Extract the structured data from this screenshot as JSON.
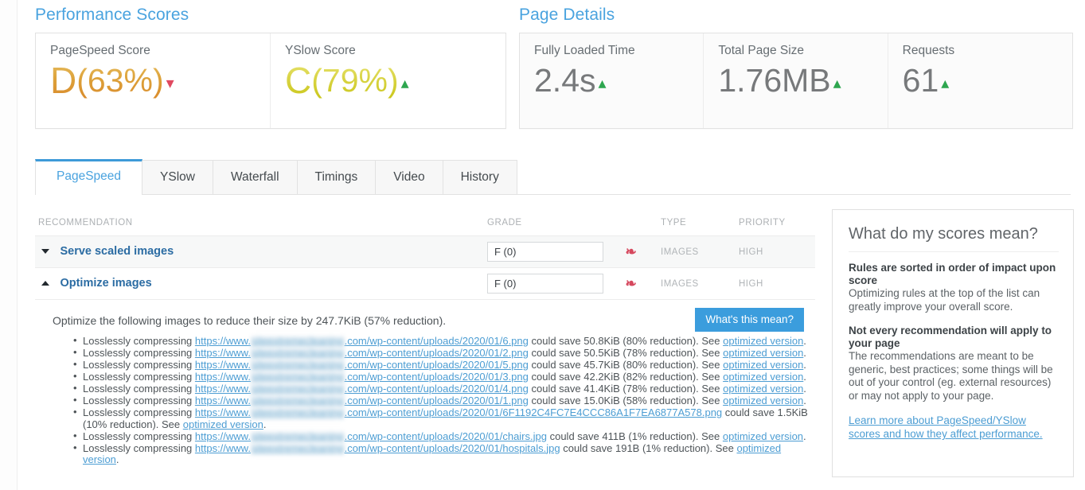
{
  "performance": {
    "heading": "Performance Scores",
    "cards": [
      {
        "label": "PageSpeed Score",
        "grade": "D",
        "percent": "(63%)",
        "trend": "down"
      },
      {
        "label": "YSlow Score",
        "grade": "C",
        "percent": "(79%)",
        "trend": "up"
      }
    ]
  },
  "page_details": {
    "heading": "Page Details",
    "cards": [
      {
        "label": "Fully Loaded Time",
        "value": "2.4s",
        "trend": "up"
      },
      {
        "label": "Total Page Size",
        "value": "1.76MB",
        "trend": "up"
      },
      {
        "label": "Requests",
        "value": "61",
        "trend": "up"
      }
    ]
  },
  "tabs": [
    {
      "label": "PageSpeed",
      "active": true
    },
    {
      "label": "YSlow",
      "active": false
    },
    {
      "label": "Waterfall",
      "active": false
    },
    {
      "label": "Timings",
      "active": false
    },
    {
      "label": "Video",
      "active": false
    },
    {
      "label": "History",
      "active": false
    }
  ],
  "table": {
    "headers": {
      "recommendation": "RECOMMENDATION",
      "grade": "GRADE",
      "type": "TYPE",
      "priority": "PRIORITY"
    },
    "rows": [
      {
        "name": "Serve scaled images",
        "toggle": "down",
        "grade": "F (0)",
        "type": "IMAGES",
        "priority": "HIGH"
      },
      {
        "name": "Optimize images",
        "toggle": "up",
        "grade": "F (0)",
        "type": "IMAGES",
        "priority": "HIGH"
      }
    ]
  },
  "detail": {
    "lead": "Optimize the following images to reduce their size by 247.7KiB (57% reduction).",
    "whats_this_mean": "What's this mean?",
    "prefix": "Losslessly compressing ",
    "url_head": "https://www.",
    "url_domain_blurred": "siteextremecleaning",
    "link_text": "optimized version",
    "items": [
      {
        "path": ".com/wp-content/uploads/2020/01/6.png",
        "save": " could save 50.8KiB (80% reduction). See ",
        "tail": "."
      },
      {
        "path": ".com/wp-content/uploads/2020/01/2.png",
        "save": " could save 50.5KiB (78% reduction). See ",
        "tail": "."
      },
      {
        "path": ".com/wp-content/uploads/2020/01/5.png",
        "save": " could save 45.7KiB (80% reduction). See ",
        "tail": "."
      },
      {
        "path": ".com/wp-content/uploads/2020/01/3.png",
        "save": " could save 42.2KiB (82% reduction). See ",
        "tail": "."
      },
      {
        "path": ".com/wp-content/uploads/2020/01/4.png",
        "save": " could save 41.4KiB (78% reduction). See ",
        "tail": "."
      },
      {
        "path": ".com/wp-content/uploads/2020/01/1.png",
        "save": " could save 15.0KiB (58% reduction). See ",
        "tail": "."
      },
      {
        "path": ".com/wp-content/uploads/2020/01/6F1192C4FC7E4CCC86A1F7EA6877A578.png",
        "save": " could save 1.5KiB (10% reduction). See ",
        "tail": "."
      },
      {
        "path": ".com/wp-content/uploads/2020/01/chairs.jpg",
        "save": " could save 411B (1% reduction). See ",
        "tail": "."
      },
      {
        "path": ".com/wp-content/uploads/2020/01/hospitals.jpg",
        "save": " could save 191B (1% reduction). See ",
        "tail": "."
      }
    ]
  },
  "info_panel": {
    "title": "What do my scores mean?",
    "sections": [
      {
        "heading": "Rules are sorted in order of impact upon score",
        "body": "Optimizing rules at the top of the list can greatly improve your overall score."
      },
      {
        "heading": "Not every recommendation will apply to your page",
        "body": "The recommendations are meant to be generic, best practices; some things will be out of your control (eg. external resources) or may not apply to your page."
      }
    ],
    "link": "Learn more about PageSpeed/YSlow scores and how they affect performance."
  },
  "colors": {
    "accent_blue": "#4aa3df",
    "grade_d": "#dda03a",
    "grade_c": "#d9d445",
    "trend_down": "#e0495f",
    "trend_up": "#2ea64f",
    "button_blue": "#3b9ddd"
  }
}
